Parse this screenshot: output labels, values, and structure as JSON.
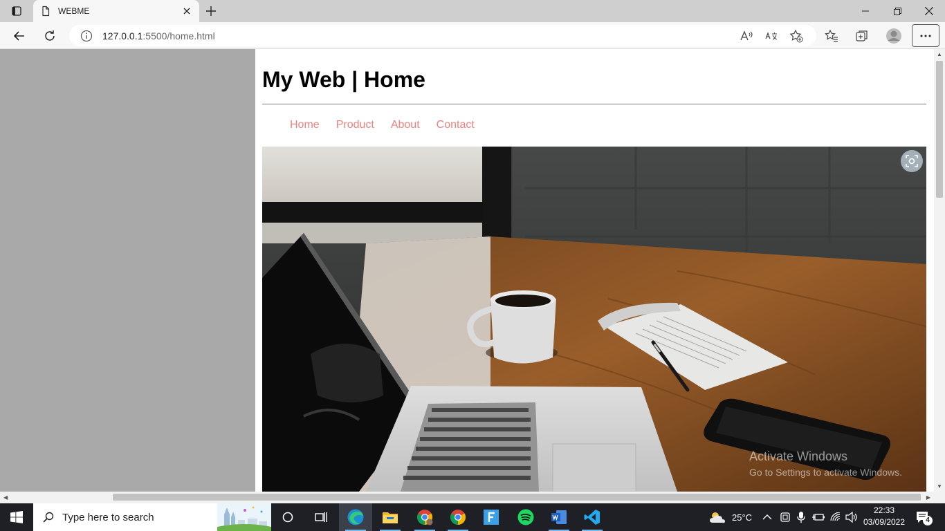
{
  "browser": {
    "tab": {
      "title": "WEBME",
      "favicon": "page-icon"
    },
    "address": {
      "host": "127.0.0.1",
      "port_path": ":5500/home.html"
    }
  },
  "page": {
    "title": "My Web | Home",
    "nav": [
      "Home",
      "Product",
      "About",
      "Contact"
    ],
    "hero_alt": "laptop-coffee-desk-photo"
  },
  "watermark": {
    "line1": "Activate Windows",
    "line2": "Go to Settings to activate Windows."
  },
  "taskbar": {
    "search_placeholder": "Type here to search",
    "weather": "25°C",
    "time": "22:33",
    "date": "03/09/2022",
    "notification_count": "4",
    "apps": [
      "task-view",
      "edge",
      "file-explorer",
      "chrome-profile",
      "chrome",
      "figma",
      "spotify",
      "word",
      "vscode"
    ]
  },
  "colors": {
    "nav_link": "#f08080",
    "left_panel": "#a9a9a9",
    "taskbar": "#1f1f26"
  }
}
